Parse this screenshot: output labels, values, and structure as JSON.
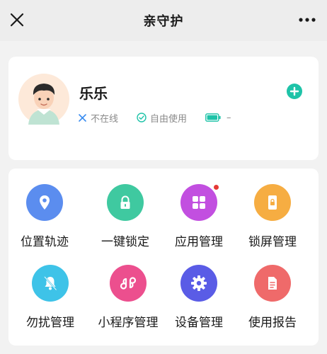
{
  "navbar": {
    "title": "亲守护"
  },
  "profile": {
    "name": "乐乐",
    "status_online": "不在线",
    "status_usage": "自由使用",
    "battery": "–"
  },
  "functions": [
    {
      "label": "位置轨迹",
      "icon": "location-pin-icon",
      "color": "#5b8def"
    },
    {
      "label": "一键锁定",
      "icon": "lock-icon",
      "color": "#3fc9a0"
    },
    {
      "label": "应用管理",
      "icon": "apps-grid-icon",
      "color": "#c24fe0",
      "badge": true
    },
    {
      "label": "锁屏管理",
      "icon": "phone-lock-icon",
      "color": "#f6ad42"
    },
    {
      "label": "勿扰管理",
      "icon": "bell-off-icon",
      "color": "#3ec3e8"
    },
    {
      "label": "小程序管理",
      "icon": "mini-program-icon",
      "color": "#ec4f8e"
    },
    {
      "label": "设备管理",
      "icon": "gear-icon",
      "color": "#5a5ce6"
    },
    {
      "label": "使用报告",
      "icon": "report-icon",
      "color": "#ef6a6a"
    }
  ],
  "colors": {
    "accent": "#1ec3a8",
    "background": "#f2f2f2",
    "card": "#ffffff"
  }
}
